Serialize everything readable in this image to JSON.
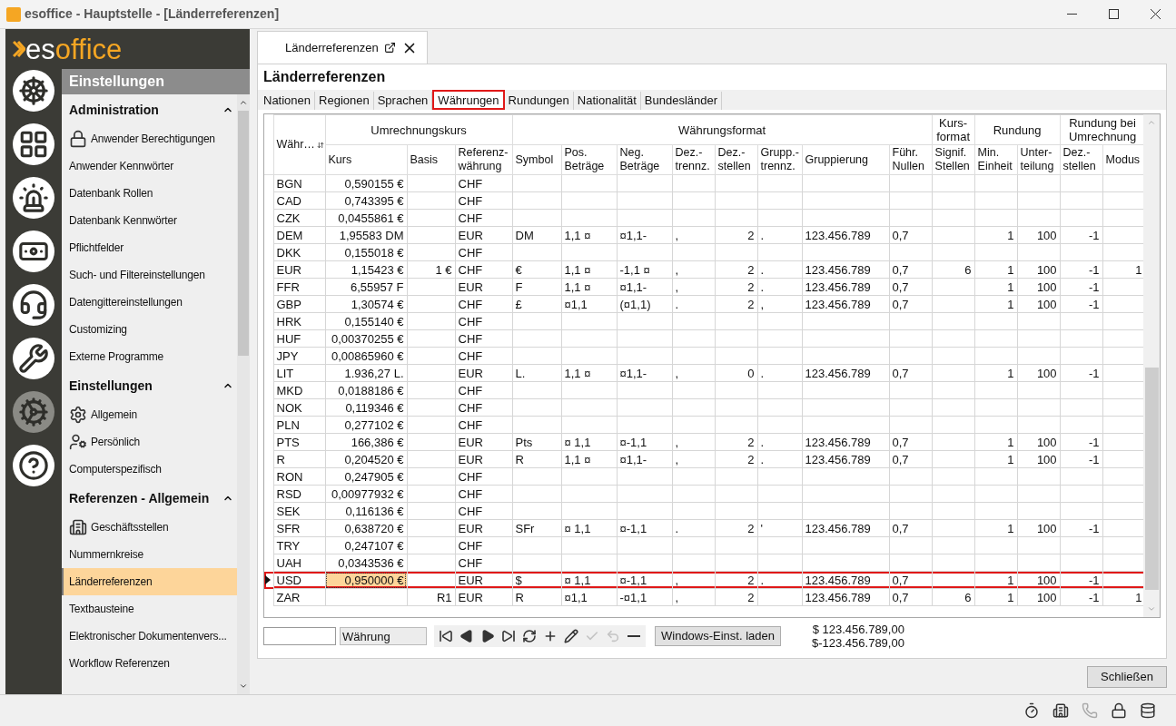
{
  "window": {
    "title": "esoffice - Hauptstelle - [Länderreferenzen]"
  },
  "logo": {
    "part_1": "es",
    "part_2": "office"
  },
  "rail": [
    {
      "kind": "wheel",
      "selected": false
    },
    {
      "kind": "grid",
      "selected": false
    },
    {
      "kind": "siren",
      "selected": false
    },
    {
      "kind": "money",
      "selected": false
    },
    {
      "kind": "headset",
      "selected": false
    },
    {
      "kind": "tools",
      "selected": false
    },
    {
      "kind": "gears",
      "selected": true
    },
    {
      "kind": "help",
      "selected": false
    }
  ],
  "sidebar": {
    "title": "Einstellungen",
    "sections": [
      {
        "label": "Administration",
        "expanded": true,
        "items": [
          {
            "label": "Anwender Berechtigungen",
            "kind": "lock",
            "selected": false
          },
          {
            "label": "Anwender Kennwörter",
            "kind": "plain",
            "selected": false
          },
          {
            "label": "Datenbank Rollen",
            "kind": "plain",
            "selected": false
          },
          {
            "label": "Datenbank Kennwörter",
            "kind": "plain",
            "selected": false
          },
          {
            "label": "Pflichtfelder",
            "kind": "plain",
            "selected": false
          },
          {
            "label": "Such- und Filtereinstellungen",
            "kind": "plain",
            "selected": false
          },
          {
            "label": "Datengittereinstellungen",
            "kind": "plain",
            "selected": false
          },
          {
            "label": "Customizing",
            "kind": "plain",
            "selected": false
          },
          {
            "label": "Externe Programme",
            "kind": "plain",
            "selected": false
          }
        ]
      },
      {
        "label": "Einstellungen",
        "expanded": true,
        "items": [
          {
            "label": "Allgemein",
            "kind": "gears",
            "selected": false
          },
          {
            "label": "Persönlich",
            "kind": "person",
            "selected": false
          },
          {
            "label": "Computerspezifisch",
            "kind": "plain",
            "selected": false
          }
        ]
      },
      {
        "label": "Referenzen - Allgemein",
        "expanded": true,
        "items": [
          {
            "label": "Geschäftsstellen",
            "kind": "building",
            "selected": false
          },
          {
            "label": "Nummernkreise",
            "kind": "plain",
            "selected": false
          },
          {
            "label": "Länderreferenzen",
            "kind": "plain",
            "selected": true
          },
          {
            "label": "Textbausteine",
            "kind": "plain",
            "selected": false
          },
          {
            "label": "Elektronischer Dokumentenvers...",
            "kind": "plain",
            "selected": false
          },
          {
            "label": "Workflow Referenzen",
            "kind": "plain",
            "selected": false
          }
        ]
      }
    ]
  },
  "document_tab": {
    "label": "Länderreferenzen"
  },
  "heading": "Länderreferenzen",
  "tabs": [
    {
      "label": "Nationen",
      "selected": false
    },
    {
      "label": "Regionen",
      "selected": false
    },
    {
      "label": "Sprachen",
      "selected": false
    },
    {
      "label": "Währungen",
      "selected": true
    },
    {
      "label": "Rundungen",
      "selected": false
    },
    {
      "label": "Nationalität",
      "selected": false
    },
    {
      "label": "Bundesländer",
      "selected": false
    }
  ],
  "table": {
    "groups": [
      {
        "columns": [
          {
            "label": "Währ…",
            "kind": "text",
            "sorted": true
          }
        ]
      },
      {
        "label": "Umrechnungskurs",
        "columns": [
          {
            "label": "Kurs",
            "kind": "number"
          },
          {
            "label": "Basis",
            "kind": "number"
          },
          {
            "label": "Referenz- währung",
            "kind": "text"
          }
        ]
      },
      {
        "label": "Währungsformat",
        "columns": [
          {
            "label": "Symbol",
            "kind": "text"
          },
          {
            "label": "Pos. Beträge",
            "kind": "text"
          },
          {
            "label": "Neg. Beträge",
            "kind": "text"
          },
          {
            "label": "Dez.- trennz.",
            "kind": "text"
          },
          {
            "label": "Dez.- stellen",
            "kind": "number"
          },
          {
            "label": "Grupp.- trennz.",
            "kind": "text"
          },
          {
            "label": "Gruppierung",
            "kind": "text"
          },
          {
            "label": "Führ. Nullen",
            "kind": "text"
          }
        ]
      },
      {
        "label": "Kurs- format",
        "columns": [
          {
            "label": "Signif. Stellen",
            "kind": "number"
          }
        ]
      },
      {
        "label": "Rundung",
        "columns": [
          {
            "label": "Min. Einheit",
            "kind": "number"
          },
          {
            "label": "Unter- teilung",
            "kind": "number"
          }
        ]
      },
      {
        "label": "Rundung bei Umrechnung",
        "columns": [
          {
            "label": "Dez.- stellen",
            "kind": "number"
          },
          {
            "label": "Modus",
            "kind": "number"
          }
        ]
      }
    ],
    "rows": [
      {
        "selected": false,
        "cells": [
          "BGN",
          "0,590155 €",
          null,
          "CHF"
        ]
      },
      {
        "selected": false,
        "cells": [
          "CAD",
          "0,743395 €",
          null,
          "CHF"
        ]
      },
      {
        "selected": false,
        "cells": [
          "CZK",
          "0,0455861 €",
          null,
          "CHF"
        ]
      },
      {
        "selected": false,
        "cells": [
          "DEM",
          "1,95583 DM",
          null,
          "EUR",
          "DM",
          "1,1 ¤",
          "¤1,1-",
          ",",
          "2",
          ".",
          "123.456.789",
          "0,7",
          null,
          "1",
          "100",
          "-1"
        ]
      },
      {
        "selected": false,
        "cells": [
          "DKK",
          "0,155018 €",
          null,
          "CHF"
        ]
      },
      {
        "selected": false,
        "cells": [
          "EUR",
          "1,15423 €",
          "1 €",
          "CHF",
          "€",
          "1,1 ¤",
          "-1,1 ¤",
          ",",
          "2",
          ".",
          "123.456.789",
          "0,7",
          "6",
          "1",
          "100",
          "-1",
          "1"
        ]
      },
      {
        "selected": false,
        "cells": [
          "FFR",
          "6,55957 F",
          null,
          "EUR",
          "F",
          "1,1 ¤",
          "¤1,1-",
          ",",
          "2",
          ".",
          "123.456.789",
          "0,7",
          null,
          "1",
          "100",
          "-1"
        ]
      },
      {
        "selected": false,
        "cells": [
          "GBP",
          "1,30574 €",
          null,
          "CHF",
          "£",
          "¤1,1",
          "(¤1,1)",
          ".",
          "2",
          ",",
          "123.456.789",
          "0,7",
          null,
          "1",
          "100",
          "-1"
        ]
      },
      {
        "selected": false,
        "cells": [
          "HRK",
          "0,155140 €",
          null,
          "CHF"
        ]
      },
      {
        "selected": false,
        "cells": [
          "HUF",
          "0,00370255 €",
          null,
          "CHF"
        ]
      },
      {
        "selected": false,
        "cells": [
          "JPY",
          "0,00865960 €",
          null,
          "CHF"
        ]
      },
      {
        "selected": false,
        "cells": [
          "LIT",
          "1.936,27 L.",
          null,
          "EUR",
          "L.",
          "1,1 ¤",
          "¤1,1-",
          ",",
          "0",
          ".",
          "123.456.789",
          "0,7",
          null,
          "1",
          "100",
          "-1"
        ]
      },
      {
        "selected": false,
        "cells": [
          "MKD",
          "0,0188186 €",
          null,
          "CHF"
        ]
      },
      {
        "selected": false,
        "cells": [
          "NOK",
          "0,119346 €",
          null,
          "CHF"
        ]
      },
      {
        "selected": false,
        "cells": [
          "PLN",
          "0,277102 €",
          null,
          "CHF"
        ]
      },
      {
        "selected": false,
        "cells": [
          "PTS",
          "166,386 €",
          null,
          "EUR",
          "Pts",
          "¤ 1,1",
          "¤-1,1",
          ",",
          "2",
          ".",
          "123.456.789",
          "0,7",
          null,
          "1",
          "100",
          "-1"
        ]
      },
      {
        "selected": false,
        "cells": [
          "R",
          "0,204520 €",
          null,
          "EUR",
          "R",
          "1,1 ¤",
          "¤1,1-",
          ",",
          "2",
          ".",
          "123.456.789",
          "0,7",
          null,
          "1",
          "100",
          "-1"
        ]
      },
      {
        "selected": false,
        "cells": [
          "RON",
          "0,247905 €",
          null,
          "CHF"
        ]
      },
      {
        "selected": false,
        "cells": [
          "RSD",
          "0,00977932 €",
          null,
          "CHF"
        ]
      },
      {
        "selected": false,
        "cells": [
          "SEK",
          "0,116136 €",
          null,
          "CHF"
        ]
      },
      {
        "selected": false,
        "cells": [
          "SFR",
          "0,638720 €",
          null,
          "EUR",
          "SFr",
          "¤ 1,1",
          "¤-1,1",
          ".",
          "2",
          "'",
          "123.456.789",
          "0,7",
          null,
          "1",
          "100",
          "-1"
        ]
      },
      {
        "selected": false,
        "cells": [
          "TRY",
          "0,247107 €",
          null,
          "CHF"
        ]
      },
      {
        "selected": false,
        "cells": [
          "UAH",
          "0,0343536 €",
          null,
          "CHF"
        ]
      },
      {
        "selected": true,
        "cells": [
          "USD",
          {
            "text": "0,950000 €",
            "focused": true
          },
          null,
          "EUR",
          "$",
          "¤ 1,1",
          "¤-1,1",
          ",",
          "2",
          ".",
          "123.456.789",
          "0,7",
          null,
          "1",
          "100",
          "-1"
        ]
      },
      {
        "selected": false,
        "cells": [
          "ZAR",
          null,
          "R1",
          "EUR",
          "R",
          "¤1,1",
          "-¤1,1",
          ",",
          "2",
          null,
          "123.456.789",
          "0,7",
          "6",
          "1",
          "100",
          "-1",
          "1"
        ]
      }
    ]
  },
  "toolbar": {
    "filter_field": {
      "value": "Währung"
    },
    "navigator": [
      {
        "kind": "first",
        "disabled": false
      },
      {
        "kind": "prev",
        "disabled": false
      },
      {
        "kind": "next",
        "disabled": false
      },
      {
        "kind": "last",
        "disabled": false
      },
      {
        "kind": "refresh",
        "disabled": false
      },
      {
        "kind": "add",
        "disabled": false
      },
      {
        "kind": "edit",
        "disabled": false
      },
      {
        "kind": "save",
        "disabled": true
      },
      {
        "kind": "undo",
        "disabled": true
      },
      {
        "kind": "delete",
        "disabled": false
      }
    ],
    "load_button": "Windows-Einst. laden",
    "preview": [
      "$ 123.456.789,00",
      "$-123.456.789,00"
    ]
  },
  "close_button": "Schließen",
  "status_bar": [
    {
      "kind": "stopwatch",
      "disabled": false
    },
    {
      "kind": "building",
      "disabled": false
    },
    {
      "kind": "phone",
      "disabled": true
    },
    {
      "kind": "lock",
      "disabled": false
    },
    {
      "kind": "database",
      "disabled": false
    }
  ]
}
